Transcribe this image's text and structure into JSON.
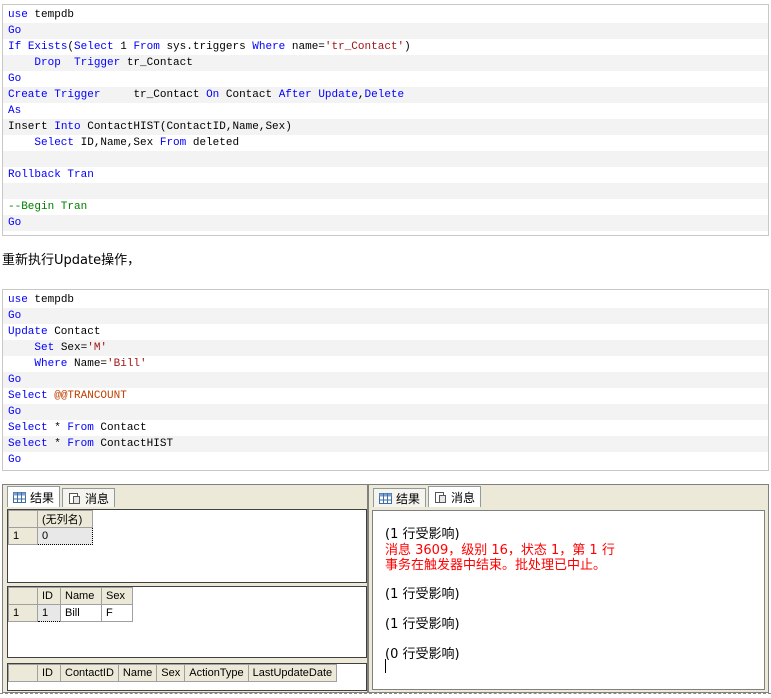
{
  "code_block_1": [
    [
      [
        "kw",
        "use"
      ],
      [
        "t",
        " tempdb"
      ]
    ],
    [
      [
        "kw",
        "Go"
      ]
    ],
    [
      [
        "kw",
        "If"
      ],
      [
        "t",
        " "
      ],
      [
        "kw",
        "Exists"
      ],
      [
        "t",
        "("
      ],
      [
        "kw",
        "Select"
      ],
      [
        "t",
        " 1 "
      ],
      [
        "kw",
        "From"
      ],
      [
        "t",
        " sys.triggers "
      ],
      [
        "kw",
        "Where"
      ],
      [
        "t",
        " name="
      ],
      [
        "str",
        "'tr_Contact'"
      ],
      [
        "t",
        ")"
      ]
    ],
    [
      [
        "t",
        "    "
      ],
      [
        "kw",
        "Drop"
      ],
      [
        "t",
        "  "
      ],
      [
        "kw",
        "Trigger"
      ],
      [
        "t",
        " tr_Contact"
      ]
    ],
    [
      [
        "kw",
        "Go"
      ]
    ],
    [
      [
        "kw",
        "Create"
      ],
      [
        "t",
        " "
      ],
      [
        "kw",
        "Trigger"
      ],
      [
        "t",
        "     tr_Contact "
      ],
      [
        "kw",
        "On"
      ],
      [
        "t",
        " Contact "
      ],
      [
        "kw",
        "After"
      ],
      [
        "t",
        " "
      ],
      [
        "kw",
        "Update"
      ],
      [
        "t",
        ","
      ],
      [
        "kw",
        "Delete"
      ]
    ],
    [
      [
        "kw",
        "As"
      ]
    ],
    [
      [
        "t",
        "Insert "
      ],
      [
        "kw",
        "Into"
      ],
      [
        "t",
        " ContactHIST(ContactID,Name,Sex)"
      ]
    ],
    [
      [
        "t",
        "    "
      ],
      [
        "kw",
        "Select"
      ],
      [
        "t",
        " ID,Name,Sex "
      ],
      [
        "kw",
        "From"
      ],
      [
        "t",
        " deleted"
      ]
    ],
    [],
    [
      [
        "kw",
        "Rollback"
      ],
      [
        "t",
        " "
      ],
      [
        "kw",
        "Tran"
      ]
    ],
    [],
    [
      [
        "cm",
        "--Begin Tran"
      ]
    ],
    [
      [
        "kw",
        "Go"
      ]
    ]
  ],
  "prose_text": "重新执行Update操作，",
  "code_block_2": [
    [
      [
        "kw",
        "use"
      ],
      [
        "t",
        " tempdb"
      ]
    ],
    [
      [
        "kw",
        "Go"
      ]
    ],
    [
      [
        "kw",
        "Update"
      ],
      [
        "t",
        " Contact"
      ]
    ],
    [
      [
        "t",
        "    "
      ],
      [
        "kw",
        "Set"
      ],
      [
        "t",
        " Sex="
      ],
      [
        "str",
        "'M'"
      ]
    ],
    [
      [
        "t",
        "    "
      ],
      [
        "kw",
        "Where"
      ],
      [
        "t",
        " Name="
      ],
      [
        "str",
        "'Bill'"
      ]
    ],
    [
      [
        "kw",
        "Go"
      ]
    ],
    [
      [
        "kw",
        "Select"
      ],
      [
        "t",
        " "
      ],
      [
        "gv",
        "@@TRANCOUNT"
      ]
    ],
    [
      [
        "kw",
        "Go"
      ]
    ],
    [
      [
        "kw",
        "Select"
      ],
      [
        "t",
        " * "
      ],
      [
        "kw",
        "From"
      ],
      [
        "t",
        " Contact"
      ]
    ],
    [
      [
        "kw",
        "Select"
      ],
      [
        "t",
        " * "
      ],
      [
        "kw",
        "From"
      ],
      [
        "t",
        " ContactHIST"
      ]
    ],
    [
      [
        "kw",
        "Go"
      ]
    ]
  ],
  "left_panel": {
    "tab_results": "结果",
    "tab_messages": "消息",
    "grid1": {
      "headers": [
        "",
        "(无列名)"
      ],
      "rows": [
        [
          "1",
          "0"
        ]
      ]
    },
    "grid2": {
      "headers": [
        "",
        "ID",
        "Name",
        "Sex"
      ],
      "rows": [
        [
          "1",
          "1",
          "Bill",
          "F"
        ]
      ]
    },
    "grid3": {
      "headers": [
        "",
        "ID",
        "ContactID",
        "Name",
        "Sex",
        "ActionType",
        "LastUpdateDate"
      ],
      "rows": []
    }
  },
  "right_panel": {
    "tab_results": "结果",
    "tab_messages": "消息",
    "messages": {
      "m1": "(1 行受影响)",
      "err1": "消息 3609，级别 16，状态 1，第 1 行",
      "err2": "事务在触发器中结束。批处理已中止。",
      "m2": "(1 行受影响)",
      "m3": "(1 行受影响)",
      "m4": "(0 行受影响)"
    }
  },
  "colors": {
    "keyword": "#0000ff",
    "string": "#a31515",
    "global_var": "#c04000",
    "comment": "#008000",
    "error": "#ff0000"
  }
}
